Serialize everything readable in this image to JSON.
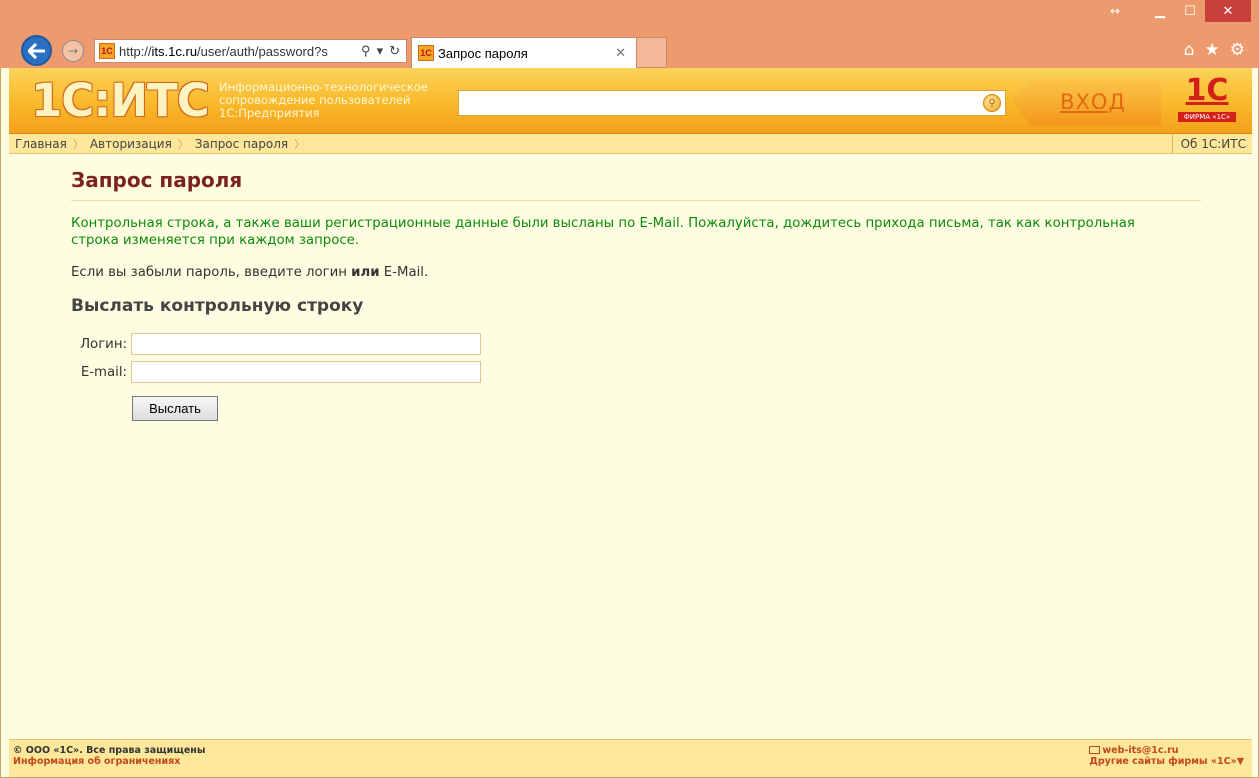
{
  "browser": {
    "address": "http://its.1c.ru/user/auth/password?s",
    "address_domain": "its.1c.ru",
    "address_prefix": "http://",
    "address_suffix": "/user/auth/password?s",
    "tab_title": "Запрос пароля",
    "favicon_text": "1С"
  },
  "header": {
    "logo": "1С:ИТС",
    "tagline": [
      "Информационно-технологическое",
      "сопровождение пользователей",
      "1С:Предприятия"
    ],
    "search_value": "",
    "login_label": "ВХОД",
    "firm_logo_big": "1С",
    "firm_logo_small": "ФИРМА «1С»"
  },
  "breadcrumbs": {
    "items": [
      "Главная",
      "Авторизация",
      "Запрос пароля"
    ],
    "right": "Об 1С:ИТС"
  },
  "content": {
    "title": "Запрос пароля",
    "success_message": "Контрольная строка, а также ваши регистрационные данные были высланы по E-Mail. Пожалуйста, дождитесь прихода письма, так как контрольная строка изменяется при каждом запросе.",
    "hint_before": "Если вы забыли пароль, введите логин ",
    "hint_bold": "или",
    "hint_after": " E-Mail.",
    "form_title": "Выслать контрольную строку",
    "login_label": "Логин:",
    "login_value": "",
    "email_label": "E-mail:",
    "email_value": "",
    "submit_label": "Выслать"
  },
  "footer": {
    "copyright": "© ООО «1С». Все права защищены",
    "restrictions_link": "Информация об ограничениях",
    "email_link": "web-its@1c.ru",
    "other_sites": "Другие сайты фирмы «1С»▼"
  },
  "colors": {
    "window_frame": "#ed9b6e",
    "header_orange": "#f9b82a",
    "title_red": "#7b2323",
    "success_green": "#0c8a0c",
    "page_bg": "#fffde1"
  }
}
